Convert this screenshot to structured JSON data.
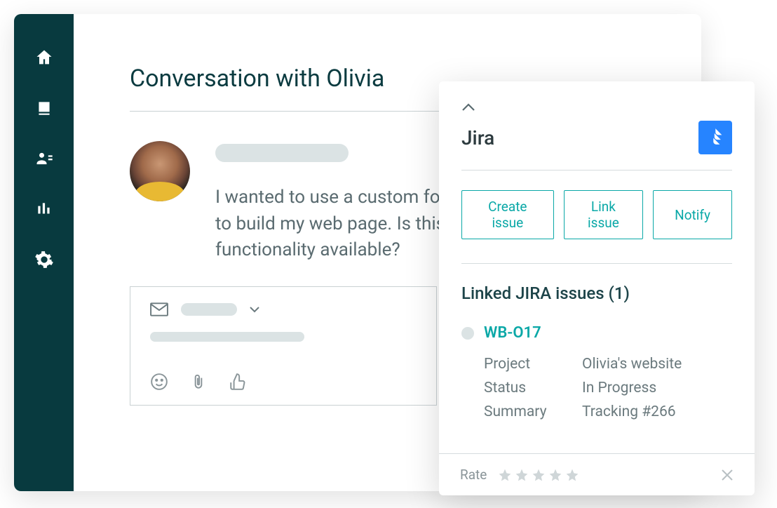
{
  "header": {
    "title": "Conversation with Olivia"
  },
  "message": {
    "text": "I wanted to use a custom font to build my web page. Is this functionality available?"
  },
  "jira": {
    "panel_title": "Jira",
    "actions": {
      "create": "Create issue",
      "link": "Link issue",
      "notify": "Notify"
    },
    "linked_heading": "Linked JIRA issues (1)",
    "issue": {
      "id": "WB-O17",
      "project_label": "Project",
      "project_value": "Olivia's website",
      "status_label": "Status",
      "status_value": "In Progress",
      "summary_label": "Summary",
      "summary_value": "Tracking #266"
    },
    "rate_label": "Rate"
  },
  "colors": {
    "sidebar_bg": "#083a3f",
    "accent": "#0aa8a7",
    "jira_blue": "#2684ff"
  }
}
